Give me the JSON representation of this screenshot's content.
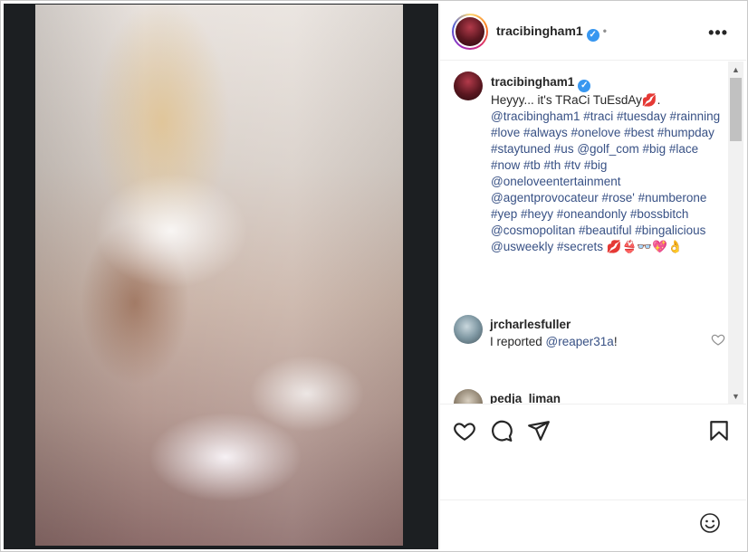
{
  "post": {
    "author": "tracibingham1",
    "verified_mark": "✓",
    "separator": "•",
    "more_glyph": "•••",
    "photo_icon": "photo-image"
  },
  "caption": {
    "user": "tracibingham1",
    "text": "Heyyy... it's TRaCi TuEsdAy💋.",
    "tags": "@tracibingham1 #traci #tuesday #rainning #love #always #onelove #best #humpday #staytuned #us @golf_com #big #lace #now #tb #th #tv #big @oneloveentertainment @agentprovocateur #rose' #numberone #yep #heyy #oneandonly #bossbitch @cosmopolitan #beautiful #bingalicious @usweekly #secrets 💋👙👓💖👌"
  },
  "comments": [
    {
      "user": "jrcharlesfuller",
      "text_prefix": "I reported ",
      "mention": "@reaper31a",
      "text_suffix": "!"
    },
    {
      "user": "pedja_liman",
      "text_prefix": "",
      "mention": "",
      "text_suffix": ""
    }
  ],
  "scrollbar": {
    "up": "▲",
    "down": "▼"
  },
  "colors": {
    "link": "#385185",
    "verified": "#3897f0",
    "text": "#262626",
    "border": "#efefef"
  },
  "icons": [
    "heart-icon",
    "comment-icon",
    "share-icon",
    "bookmark-icon",
    "emoji-icon",
    "more-icon"
  ]
}
